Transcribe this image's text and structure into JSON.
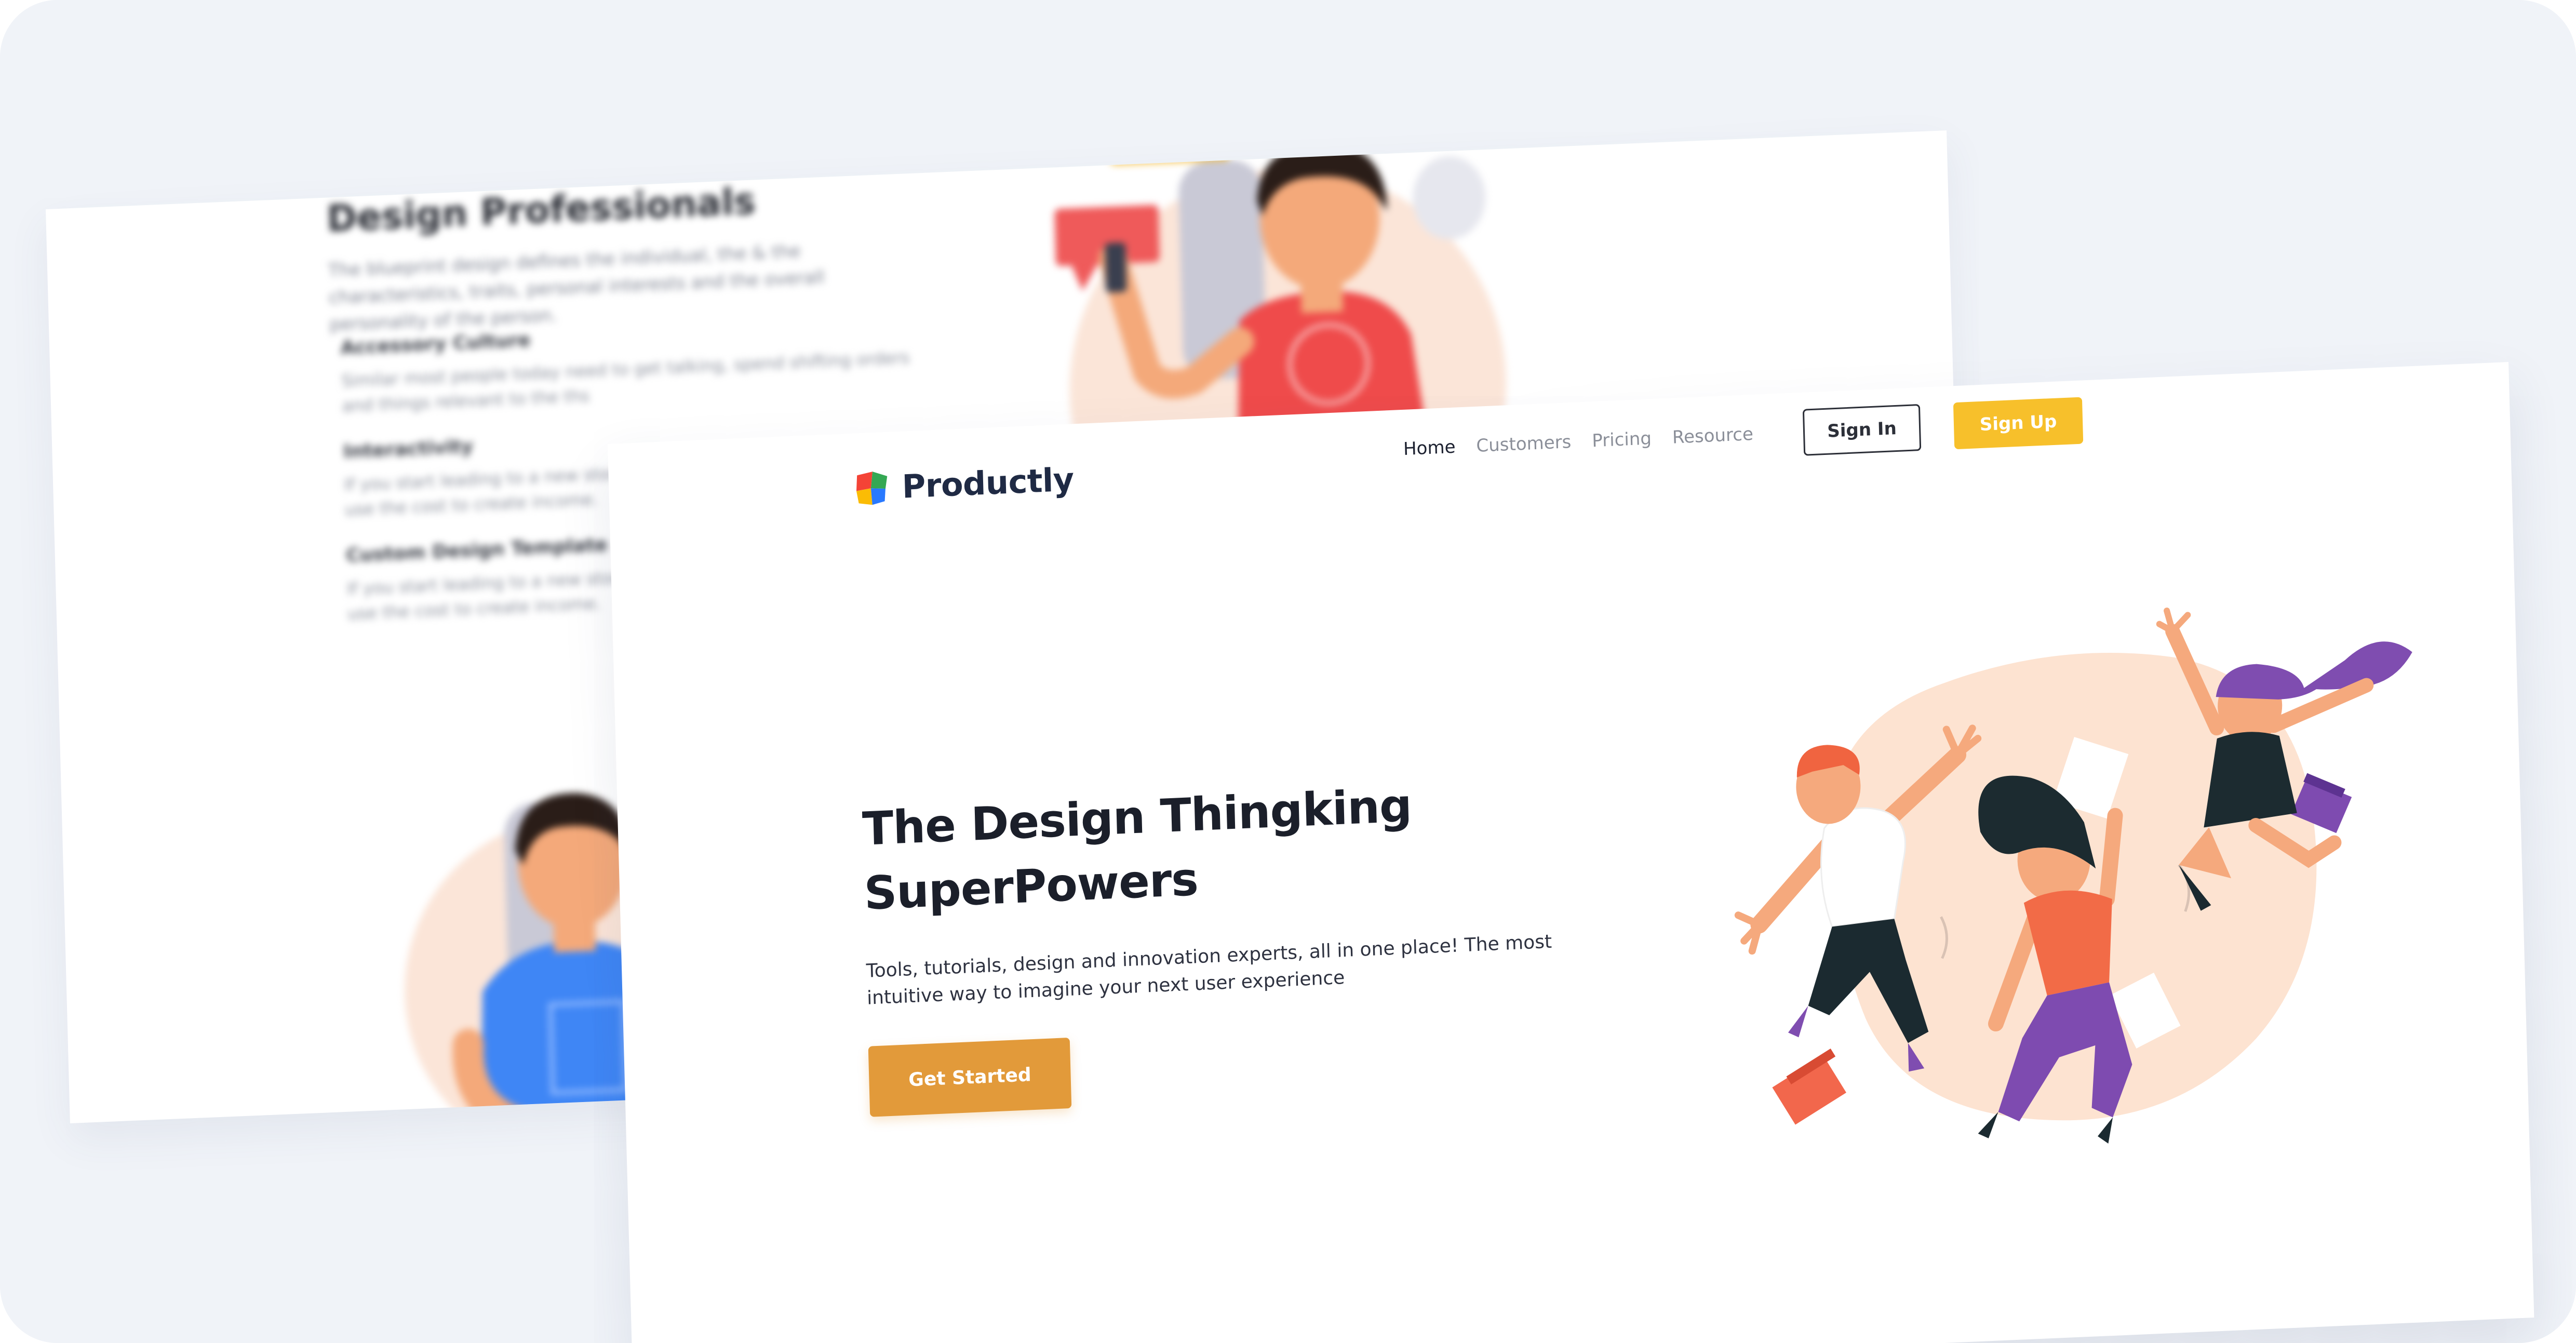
{
  "back_page": {
    "title": "Design Professionals",
    "intro": "The blueprint design defines the individual, the & the characteristics, traits, personal interests and the overall personality of the person.",
    "sections": [
      {
        "heading": "Accessory Culture",
        "text": "Similar most people today need to get talking, spend shifting orders and things relevant to the ths"
      },
      {
        "heading": "Interactivity",
        "text": "If you start leading to a new story from the sta a class today you use the cost to create income."
      },
      {
        "heading": "Custom Design Template",
        "text": "If you start leading to a new story from the sta a class today you use the cost to create income."
      }
    ]
  },
  "front_page": {
    "brand": {
      "name": "Productly",
      "logo_icon": "productly-logo-icon"
    },
    "nav": {
      "items": [
        {
          "label": "Home",
          "active": true
        },
        {
          "label": "Customers",
          "active": false
        },
        {
          "label": "Pricing",
          "active": false
        },
        {
          "label": "Resource",
          "active": false
        }
      ],
      "sign_in": "Sign In",
      "sign_up": "Sign Up"
    },
    "hero": {
      "title_line1": "The Design Thingking",
      "title_line2": "SuperPowers",
      "subtitle": "Tools, tutorials, design and innovation experts, all in one place! The most intuitive way to imagine your next user experience",
      "cta": "Get Started",
      "illustration": "three-people-jumping-illustration"
    }
  },
  "colors": {
    "background": "#f0f3f8",
    "accent_yellow": "#f7c02b",
    "cta_orange": "#e29a3a",
    "text_dark": "#1b1f2a",
    "nav_muted": "#8b8f99"
  }
}
